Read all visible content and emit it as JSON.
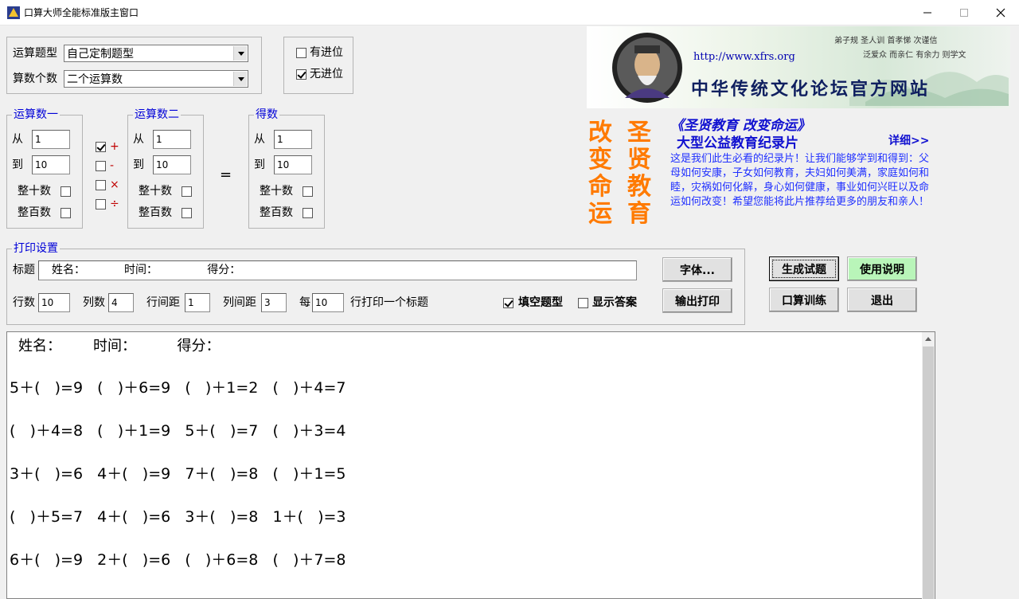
{
  "window": {
    "title": "口算大师全能标准版主窗口",
    "minimize": "—",
    "maximize": "☐",
    "close": "✕"
  },
  "settings": {
    "type_label": "运算题型",
    "type_value": "自己定制题型",
    "count_label": "算数个数",
    "count_value": "二个运算数"
  },
  "carry": {
    "with_carry": "有进位",
    "with_carry_checked": false,
    "no_carry": "无进位",
    "no_carry_checked": true
  },
  "operand1": {
    "legend": "运算数一",
    "from_label": "从",
    "from_value": "1",
    "to_label": "到",
    "to_value": "10",
    "tens_label": "整十数",
    "hundreds_label": "整百数"
  },
  "operators": {
    "plus": "+",
    "plus_checked": true,
    "minus": "-",
    "times": "×",
    "divide": "÷"
  },
  "operand2": {
    "legend": "运算数二",
    "from_label": "从",
    "from_value": "1",
    "to_label": "到",
    "to_value": "10",
    "tens_label": "整十数",
    "hundreds_label": "整百数"
  },
  "equals": "=",
  "result": {
    "legend": "得数",
    "from_label": "从",
    "from_value": "1",
    "to_label": "到",
    "to_value": "10",
    "tens_label": "整十数",
    "hundreds_label": "整百数"
  },
  "print": {
    "legend": "打印设置",
    "title_label": "标题",
    "title_value": "姓名：           时间：              得分：",
    "rows_label": "行数",
    "rows_value": "10",
    "cols_label": "列数",
    "cols_value": "4",
    "row_spacing_label": "行间距",
    "row_spacing_value": "1",
    "col_spacing_label": "列间距",
    "col_spacing_value": "3",
    "every_label": "每",
    "every_value": "10",
    "every_suffix": "行打印一个标题",
    "fill_blank_label": "填空题型",
    "fill_blank_checked": true,
    "show_answer_label": "显示答案",
    "show_answer_checked": false,
    "font_button": "字体...",
    "output_button": "输出打印"
  },
  "actions": {
    "generate": "生成试题",
    "manual": "使用说明",
    "training": "口算训练",
    "exit": "退出"
  },
  "banner": {
    "small_line1": "弟子规  圣人训  首孝悌  次谨信",
    "small_line2": "泛爱众  而亲仁  有余力  则学文",
    "url": "http://www.xfrs.org",
    "title": "中华传统文化论坛官方网站"
  },
  "promo": {
    "vertical_left": "改变命运",
    "vertical_right": "圣贤教育",
    "title": "《圣贤教育 改变命运》",
    "subtitle": "大型公益教育纪录片",
    "more": "详细>>",
    "body": "这是我们此生必看的纪录片！让我们能够学到和得到：父母如何安康，子女如何教育，夫妇如何美满，家庭如何和睦，灾祸如何化解，身心如何健康，事业如何兴旺以及命运如何改变！希望您能将此片推荐给更多的朋友和亲人！"
  },
  "preview": {
    "header": "姓名：       时间：         得分：",
    "rows": [
      "5＋(   )=9   (   )＋6=9   (   )＋1=2   (   )＋4=7",
      "(   )＋4=8   (   )＋1=9   5＋(   )=7   (   )＋3=4",
      "3＋(   )=6   4＋(   )=9   7＋(   )=8   (   )＋1=5",
      "(   )＋5=7   4＋(   )=6   3＋(   )=8   1＋(   )=3",
      "6＋(   )=9   2＋(   )=6   (   )＋6=8   (   )＋7=8"
    ]
  }
}
